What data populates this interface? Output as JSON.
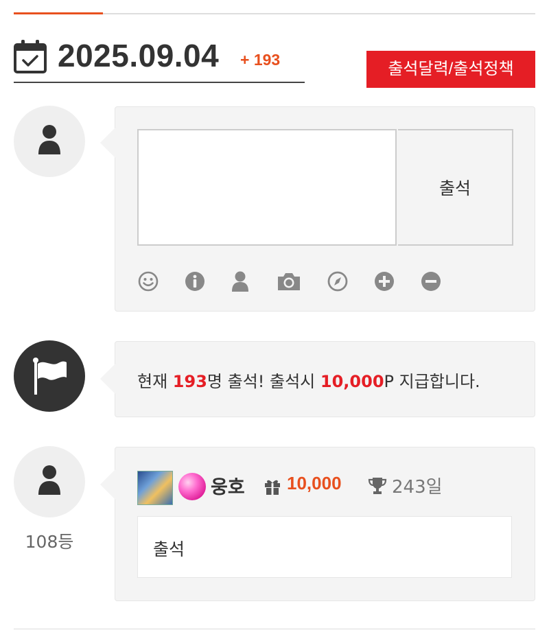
{
  "header": {
    "date": "2025.09.04",
    "count": "+ 193",
    "policy_button": "출석달력/출석정책"
  },
  "form": {
    "memo_placeholder": "",
    "submit_label": "출석",
    "tools": [
      "smile-icon",
      "info-icon",
      "user-icon",
      "camera-icon",
      "compass-icon",
      "plus-icon",
      "minus-icon"
    ]
  },
  "info": {
    "prefix": "현재 ",
    "count": "193",
    "middle": "명 출석! 출석시 ",
    "points": "10,000",
    "suffix": "P 지급합니다."
  },
  "entry": {
    "rank": "108등",
    "nickname": "웅호",
    "points": "10,000",
    "days": "243일",
    "message": "출석"
  },
  "colors": {
    "accent": "#e8501e",
    "red": "#e51e25",
    "bubble": "#f4f4f4"
  }
}
